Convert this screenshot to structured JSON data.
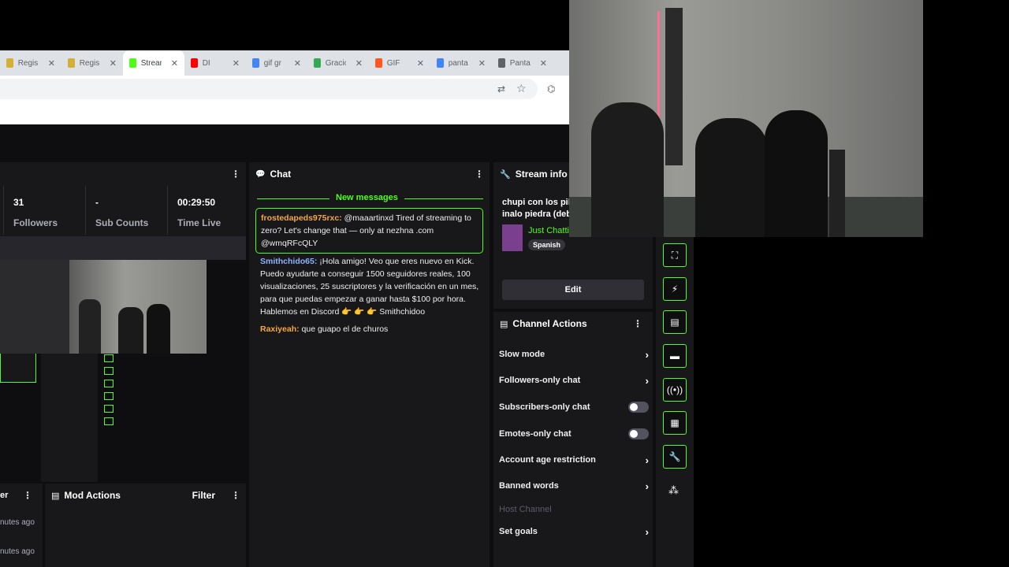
{
  "browser": {
    "tabs": [
      {
        "label": "Regis",
        "fav": "#d4af37",
        "icon": "site-icon"
      },
      {
        "label": "Regis",
        "fav": "#d4af37",
        "icon": "site-icon"
      },
      {
        "label": "Strean",
        "fav": "#53fc18",
        "icon": "kick-icon",
        "active": true
      },
      {
        "label": "DI",
        "fav": "#ff0000",
        "icon": "youtube-icon"
      },
      {
        "label": "gif gr",
        "fav": "#4285f4",
        "icon": "google-icon"
      },
      {
        "label": "Gracic",
        "fav": "#34a853",
        "icon": "site-icon"
      },
      {
        "label": "GIF",
        "fav": "#ff5722",
        "icon": "site-icon"
      },
      {
        "label": "panta",
        "fav": "#4285f4",
        "icon": "google-icon"
      },
      {
        "label": "Panta",
        "fav": "#5f6368",
        "icon": "monitor-icon"
      }
    ]
  },
  "stats": {
    "followers": {
      "value": "31",
      "label": "Followers"
    },
    "subs": {
      "value": "-",
      "label": "Sub Counts"
    },
    "time": {
      "value": "00:29:50",
      "label": "Time Live"
    }
  },
  "chat": {
    "title": "Chat",
    "new_messages": "New messages",
    "messages": [
      {
        "user": "frostedapeds975rxc:",
        "color": "#f5a742",
        "text": " @maaartinxd Tired of streaming to zero? Let's change that — only at nezhna .com @wmqRFcQLY",
        "highlight": true
      },
      {
        "user": "Smithchido65:",
        "color": "#8cb4ff",
        "text": " ¡Hola amigo! Veo que eres nuevo en Kick. Puedo ayudarte a conseguir 1500 seguidores reales, 100 visualizaciones, 25 suscriptores y la verificación en un mes, para que puedas empezar a ganar hasta $100 por hora. Hablemos en Discord 👉 👉 👉 Smithchidoo"
      },
      {
        "user": "Raxiyeah:",
        "color": "#f5a742",
        "text": " que guapo el de churos"
      }
    ]
  },
  "stream_info": {
    "title": "Stream info",
    "stream_title": "chupi con los pib inalo piedra (deb",
    "category": "Just Chatti",
    "language": "Spanish",
    "edit": "Edit"
  },
  "channel_actions": {
    "title": "Channel Actions",
    "items": [
      {
        "label": "Slow mode",
        "kind": "chevron"
      },
      {
        "label": "Followers-only chat",
        "kind": "chevron"
      },
      {
        "label": "Subscribers-only chat",
        "kind": "toggle"
      },
      {
        "label": "Emotes-only chat",
        "kind": "toggle"
      },
      {
        "label": "Account age restriction",
        "kind": "chevron"
      },
      {
        "label": "Banned words",
        "kind": "chevron"
      },
      {
        "label": "Host Channel",
        "kind": "disabled"
      },
      {
        "label": "Set goals",
        "kind": "chevron"
      }
    ]
  },
  "mod_actions": {
    "title": "Mod Actions",
    "filter": "Filter"
  },
  "left_bottom": {
    "title_tail": "er",
    "times": [
      "nutes ago",
      "nutes ago"
    ]
  },
  "side_icons": [
    "screenshot-icon",
    "bolt-icon",
    "notes-icon",
    "chat-bubble-icon",
    "broadcast-icon",
    "layout-icon",
    "wrench-icon",
    "bubbles-icon"
  ],
  "colors": {
    "accent": "#53fc18",
    "panel": "#18181b",
    "bg": "#0e0e10"
  }
}
